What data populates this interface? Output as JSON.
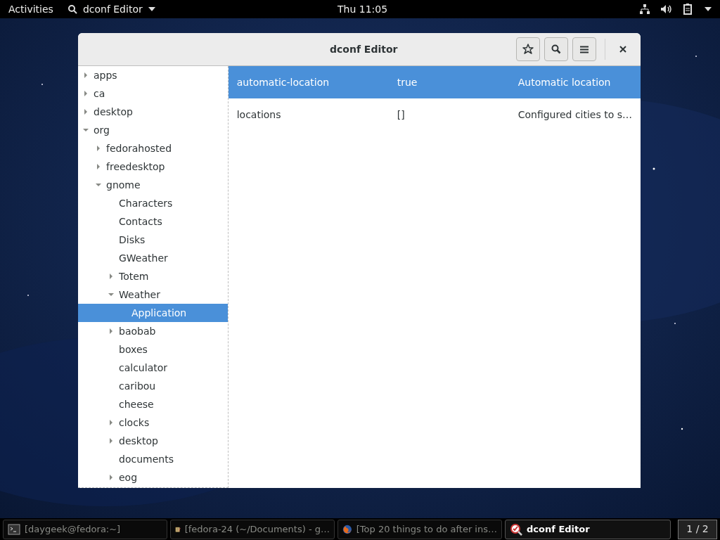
{
  "top_bar": {
    "activities": "Activities",
    "app_menu": "dconf Editor",
    "clock": "Thu 11:05"
  },
  "window": {
    "title": "dconf Editor"
  },
  "tree": [
    {
      "label": "apps",
      "kind": "folder",
      "expanded": false,
      "selected": false
    },
    {
      "label": "ca",
      "kind": "folder",
      "expanded": false,
      "selected": false
    },
    {
      "label": "desktop",
      "kind": "folder",
      "expanded": false,
      "selected": false
    },
    {
      "label": "org",
      "kind": "folder",
      "expanded": true,
      "selected": false,
      "children": [
        {
          "label": "fedorahosted",
          "kind": "folder",
          "expanded": false,
          "selected": false
        },
        {
          "label": "freedesktop",
          "kind": "folder",
          "expanded": false,
          "selected": false
        },
        {
          "label": "gnome",
          "kind": "folder",
          "expanded": true,
          "selected": false,
          "children": [
            {
              "label": "Characters",
              "kind": "leaf",
              "expanded": false,
              "selected": false
            },
            {
              "label": "Contacts",
              "kind": "leaf",
              "expanded": false,
              "selected": false
            },
            {
              "label": "Disks",
              "kind": "leaf",
              "expanded": false,
              "selected": false
            },
            {
              "label": "GWeather",
              "kind": "leaf",
              "expanded": false,
              "selected": false
            },
            {
              "label": "Totem",
              "kind": "folder",
              "expanded": false,
              "selected": false
            },
            {
              "label": "Weather",
              "kind": "folder",
              "expanded": true,
              "selected": false,
              "children": [
                {
                  "label": "Application",
                  "kind": "leaf",
                  "expanded": false,
                  "selected": true
                }
              ]
            },
            {
              "label": "baobab",
              "kind": "folder",
              "expanded": false,
              "selected": false
            },
            {
              "label": "boxes",
              "kind": "leaf",
              "expanded": false,
              "selected": false
            },
            {
              "label": "calculator",
              "kind": "leaf",
              "expanded": false,
              "selected": false
            },
            {
              "label": "caribou",
              "kind": "leaf",
              "expanded": false,
              "selected": false
            },
            {
              "label": "cheese",
              "kind": "leaf",
              "expanded": false,
              "selected": false
            },
            {
              "label": "clocks",
              "kind": "folder",
              "expanded": false,
              "selected": false
            },
            {
              "label": "desktop",
              "kind": "folder",
              "expanded": false,
              "selected": false
            },
            {
              "label": "documents",
              "kind": "leaf",
              "expanded": false,
              "selected": false
            },
            {
              "label": "eog",
              "kind": "folder",
              "expanded": false,
              "selected": false
            }
          ]
        }
      ]
    }
  ],
  "keys": [
    {
      "name": "automatic-location",
      "value": "true",
      "summary": "Automatic location",
      "selected": true
    },
    {
      "name": "locations",
      "value": "[]",
      "summary": "Configured cities to s…",
      "selected": false
    }
  ],
  "taskbar": [
    {
      "label": "[daygeek@fedora:~]",
      "kind": "terminal",
      "selected": false
    },
    {
      "label": "[fedora-24 (~/Documents) - g…",
      "kind": "editor",
      "selected": false
    },
    {
      "label": "[Top 20 things to do after ins…",
      "kind": "browser",
      "selected": false
    },
    {
      "label": "dconf Editor",
      "kind": "dconf",
      "selected": true
    }
  ],
  "workspace": "1 / 2"
}
